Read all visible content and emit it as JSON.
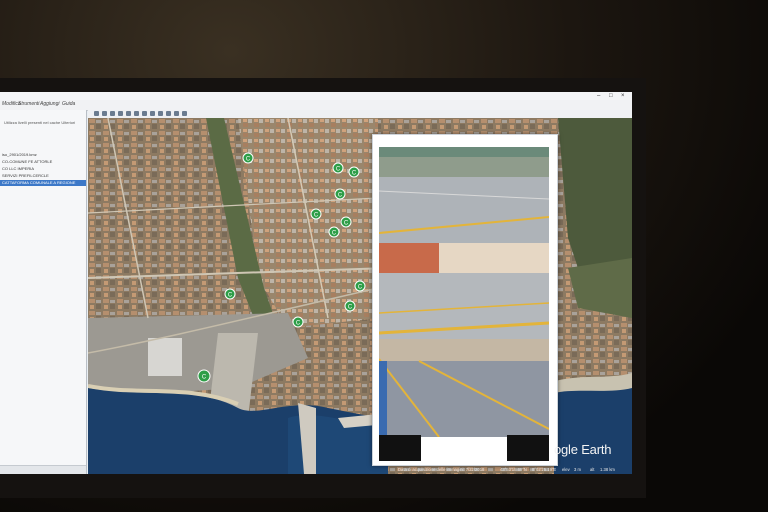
{
  "menu": {
    "items": [
      "Modifica",
      "Strumenti",
      "Aggiungi",
      "Guida"
    ]
  },
  "sidebar": {
    "header": "Utilizza livelli presenti nel cache   Ulteriori",
    "items": [
      {
        "label": "iso_2901/2019.kmz",
        "selected": false
      },
      {
        "label": "CO-COMUNE FE ATTORLE",
        "selected": false
      },
      {
        "label": "CO LLC IMPERIA",
        "selected": false
      },
      {
        "label": "SERVIZI PREFILCERCLE",
        "selected": false
      },
      {
        "label": "CATTAFORMA COMUNALE A REGIONE",
        "selected": true
      }
    ]
  },
  "map": {
    "markers": [
      {
        "label": "C"
      },
      {
        "label": "C"
      },
      {
        "label": "C"
      },
      {
        "label": "C"
      },
      {
        "label": "C"
      },
      {
        "label": "C"
      },
      {
        "label": "C"
      },
      {
        "label": "C"
      },
      {
        "label": "C"
      },
      {
        "label": "C"
      },
      {
        "label": "C"
      },
      {
        "label": "C"
      }
    ]
  },
  "brand": {
    "text": "ogle Earth"
  },
  "status": {
    "date": "Data di acquisizione delle immagini: 7/22/2018",
    "lat": "43°53'15.69\"N",
    "lon": "8°02'25.19\"E",
    "elev": "elev",
    "elev_val": "3 m",
    "alt": "alt",
    "alt_val": "1.38 km"
  },
  "colors": {
    "accent": "#3c78c8",
    "marker": "#2e9e48",
    "sea": "#1b3f6a"
  },
  "icons": [
    "window-minimize-icon",
    "window-maximize-icon",
    "window-close-icon"
  ]
}
